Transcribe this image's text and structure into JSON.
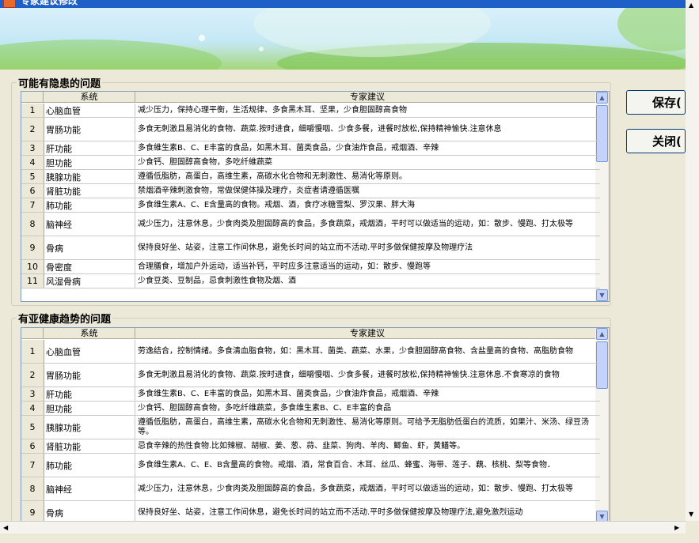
{
  "window": {
    "title": "专家建议修改"
  },
  "buttons": {
    "save": "保存(",
    "close": "关闭("
  },
  "section1": {
    "legend": "可能有隐患的问题",
    "headers": {
      "system": "系统",
      "advice": "专家建议"
    },
    "rows": [
      {
        "n": "1",
        "system": "心脑血管",
        "advice": "减少压力，保持心理平衡，生活规律、多食黑木耳、坚果，少食胆固醇高食物"
      },
      {
        "n": "2",
        "system": "胃肠功能",
        "advice": "多食无刺激且易消化的食物、蔬菜.按时进食，细嚼慢咽、少食多餐，进餐时放松,保持精神愉快.注意休息"
      },
      {
        "n": "3",
        "system": "肝功能",
        "advice": "多食維生素B、C、E丰富的食品，如黑木耳、菌类食品，少食油炸食品，戒烟酒、辛辣"
      },
      {
        "n": "4",
        "system": "胆功能",
        "advice": "少食钙、胆固醇高食物，多吃纤維蔬菜"
      },
      {
        "n": "5",
        "system": "胰腺功能",
        "advice": "遵循低脂肪，高蛋白，高维生素，高碳水化合物和无刺激性、易消化等原则。"
      },
      {
        "n": "6",
        "system": "肾脏功能",
        "advice": "禁烟酒辛辣刺激食物，常做保健体操及理疗，炎症者请遵循医嘱"
      },
      {
        "n": "7",
        "system": "肺功能",
        "advice": "多食维生素A、C、E含量高的食物。戒烟、酒，食疗冰糖雪梨、罗汉果、胖大海"
      },
      {
        "n": "8",
        "system": "脑神经",
        "advice": "减少压力，注意休息，少食肉类及胆固醇高的食品，多食蔬菜，戒烟酒，平时可以做适当的运动，如：散步、慢跑、打太极等"
      },
      {
        "n": "9",
        "system": "骨病",
        "advice": "保持良好坐、站姿，注意工作间休息，避免长时间的站立而不活动.平时多做保健按摩及物理疗法"
      },
      {
        "n": "10",
        "system": "骨密度",
        "advice": "合理膳食，增加户外运动，适当补钙，平时应多注意适当的运动，如：散步、慢跑等"
      },
      {
        "n": "11",
        "system": "风湿骨病",
        "advice": "少食豆类、豆制品，忌食刺激性食物及烟、酒"
      }
    ]
  },
  "section2": {
    "legend": "有亚健康趋势的问题",
    "headers": {
      "system": "系统",
      "advice": "专家建议"
    },
    "rows": [
      {
        "n": "1",
        "system": "心脑血管",
        "advice": "劳逸结合，控制情绪。多食清血脂食物，如：黑木耳、菌类、蔬菜、水果，少食胆固醇高食物、含盐量高的食物、高脂肪食物"
      },
      {
        "n": "2",
        "system": "胃肠功能",
        "advice": "多食无刺激且易消化的食物、蔬菜.按时进食，细嚼慢咽、少食多餐，进餐时放松,保持精神愉快.注意休息.不食寒凉的食物"
      },
      {
        "n": "3",
        "system": "肝功能",
        "advice": "多食维生素B、C、E丰富的食品，如黑木耳、菌类食品，少食油炸食品，戒烟酒、辛辣"
      },
      {
        "n": "4",
        "system": "胆功能",
        "advice": "少食钙、胆固醇高食物，多吃纤维蔬菜，多食维生素B、C、E丰富的食品"
      },
      {
        "n": "5",
        "system": "胰腺功能",
        "advice": "遵循低脂肪，高蛋白，高维生素，高碳水化合物和无刺激性、易消化等原则。可给予无脂肪低蛋白的流质，如果汁、米汤、绿豆汤等。"
      },
      {
        "n": "6",
        "system": "肾脏功能",
        "advice": "忌食辛辣的热性食物.比如辣椒、胡椒、姜、葱、蒜、韭菜、狗肉、羊肉、鲫鱼、虾，黄鳝等。"
      },
      {
        "n": "7",
        "system": "肺功能",
        "advice": "多食维生素A、C、E、B含量高的食物。戒烟、酒，常食百合、木耳、丝瓜、蜂蜜、海带、莲子、藕、核桃、梨等食物．"
      },
      {
        "n": "8",
        "system": "脑神经",
        "advice": "减少压力，注意休息，少食肉类及胆固醇高的食品，多食蔬菜，戒烟酒，平时可以做适当的运动，如：散步、慢跑、打太极等"
      },
      {
        "n": "9",
        "system": "骨病",
        "advice": "保持良好坐、站姿，注意工作间休息，避免长时间的站立而不活动.平时多做保健按摩及物理疗法,避免激烈运动"
      }
    ]
  }
}
